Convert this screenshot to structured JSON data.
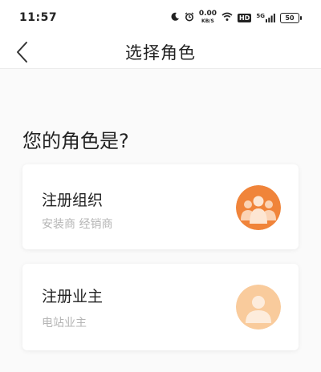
{
  "status_bar": {
    "time": "11:57",
    "net_speed": "0.00",
    "net_unit": "KB/S",
    "hd": "HD",
    "signal": "5G",
    "battery": "50"
  },
  "nav": {
    "title": "选择角色"
  },
  "question": "您的角色是?",
  "roles": [
    {
      "title": "注册组织",
      "subtitle": "安装商 经销商",
      "icon": "group-people-icon",
      "color": "#f0843a"
    },
    {
      "title": "注册业主",
      "subtitle": "电站业主",
      "icon": "single-person-icon",
      "color": "#f9cb9c"
    }
  ]
}
